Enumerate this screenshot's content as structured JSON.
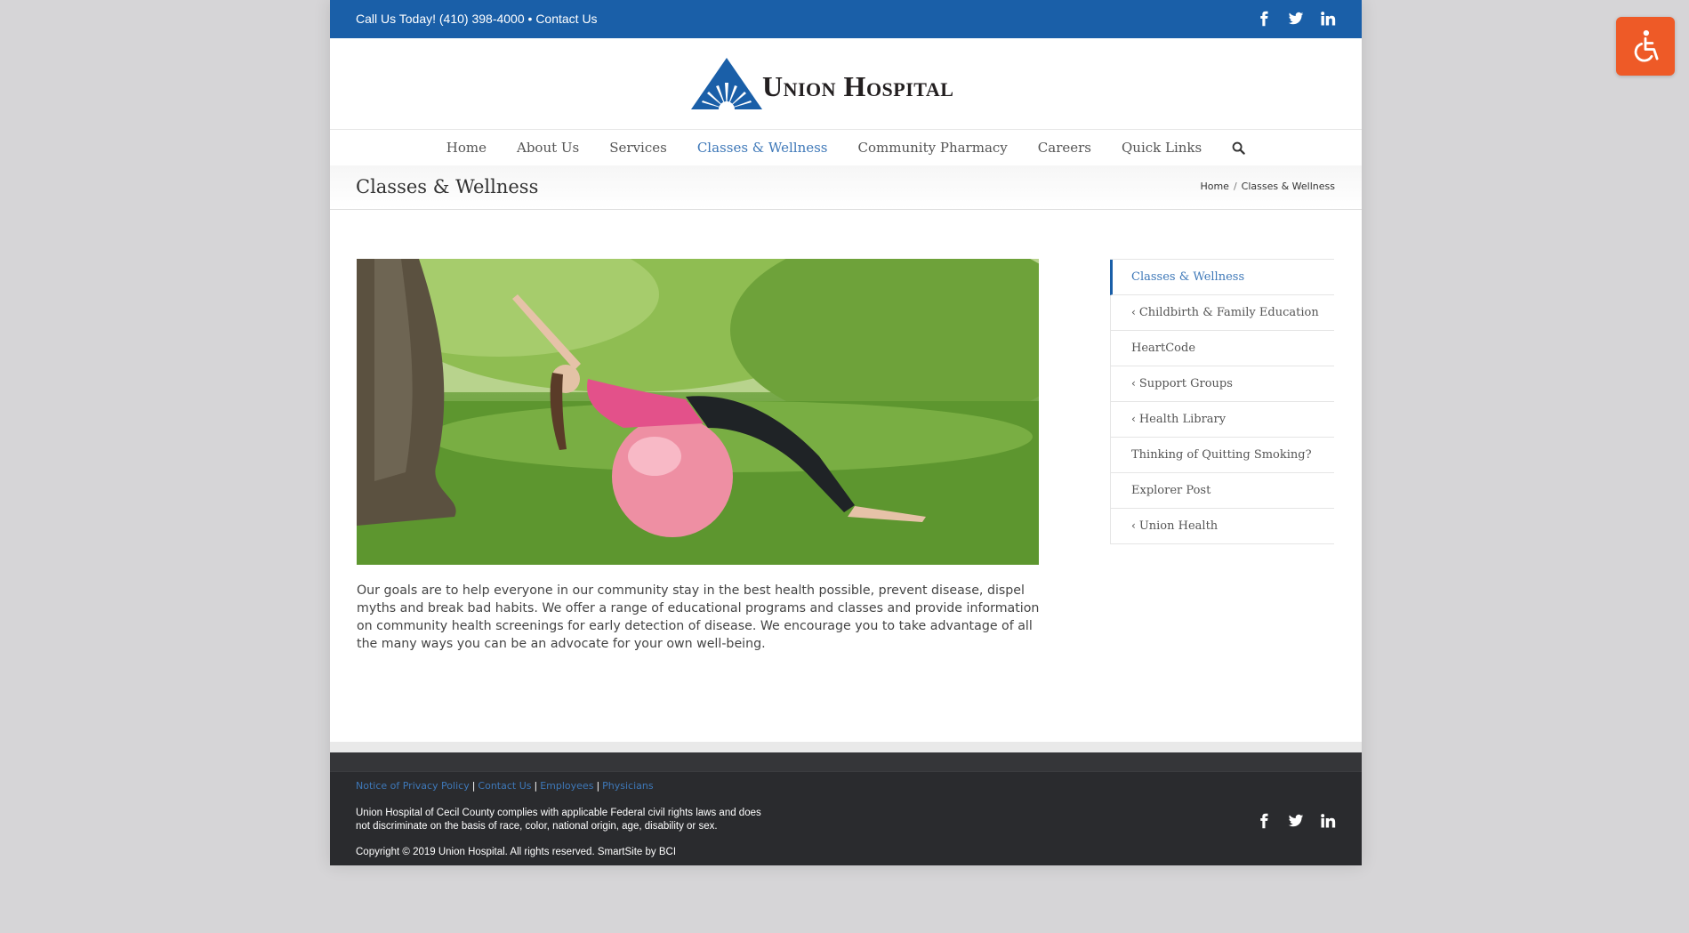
{
  "topbar": {
    "contact_text": "Call Us Today! (410) 398-4000 •",
    "contact_link": "Contact Us",
    "social": [
      "facebook-icon",
      "twitter-icon",
      "linkedin-icon"
    ]
  },
  "brand": {
    "name": "Union Hospital",
    "color_primary": "#1a5fa8",
    "color_accent": "#3e78b8"
  },
  "nav": {
    "items": [
      {
        "label": "Home",
        "active": false
      },
      {
        "label": "About Us",
        "active": false
      },
      {
        "label": "Services",
        "active": false
      },
      {
        "label": "Classes & Wellness",
        "active": true
      },
      {
        "label": "Community Pharmacy",
        "active": false
      },
      {
        "label": "Careers",
        "active": false
      },
      {
        "label": "Quick Links",
        "active": false
      }
    ],
    "search_icon": "search-icon"
  },
  "page": {
    "title": "Classes & Wellness",
    "breadcrumb": [
      "Home",
      "Classes & Wellness"
    ],
    "body": "Our goals are to help everyone in our community stay in the best health possible, prevent disease, dispel myths and break bad habits. We offer a range of educational programs and classes and provide information on community health screenings for early detection of disease. We encourage you to take advantage of all the many ways you can be an advocate for your own well-being."
  },
  "sidebar": {
    "items": [
      {
        "label": "Classes & Wellness",
        "has_children": false,
        "active": true
      },
      {
        "label": "Childbirth & Family Education",
        "has_children": true,
        "active": false
      },
      {
        "label": "HeartCode",
        "has_children": false,
        "active": false
      },
      {
        "label": "Support Groups",
        "has_children": true,
        "active": false
      },
      {
        "label": "Health Library",
        "has_children": true,
        "active": false
      },
      {
        "label": "Thinking of Quitting Smoking?",
        "has_children": false,
        "active": false
      },
      {
        "label": "Explorer Post",
        "has_children": false,
        "active": false
      },
      {
        "label": "Union Health",
        "has_children": true,
        "active": false
      }
    ]
  },
  "footer": {
    "links": [
      "Notice of Privacy Policy",
      "Contact Us",
      "Employees",
      "Physicians"
    ],
    "legal": "Union Hospital of Cecil County complies with applicable Federal civil rights laws and does not discriminate on the basis of race, color, national origin, age, disability or sex.",
    "copyright": "Copyright © 2019 Union Hospital. All rights reserved. SmartSite by BCI"
  },
  "accessibility": {
    "icon": "wheelchair-icon",
    "color": "#ee5a27"
  }
}
